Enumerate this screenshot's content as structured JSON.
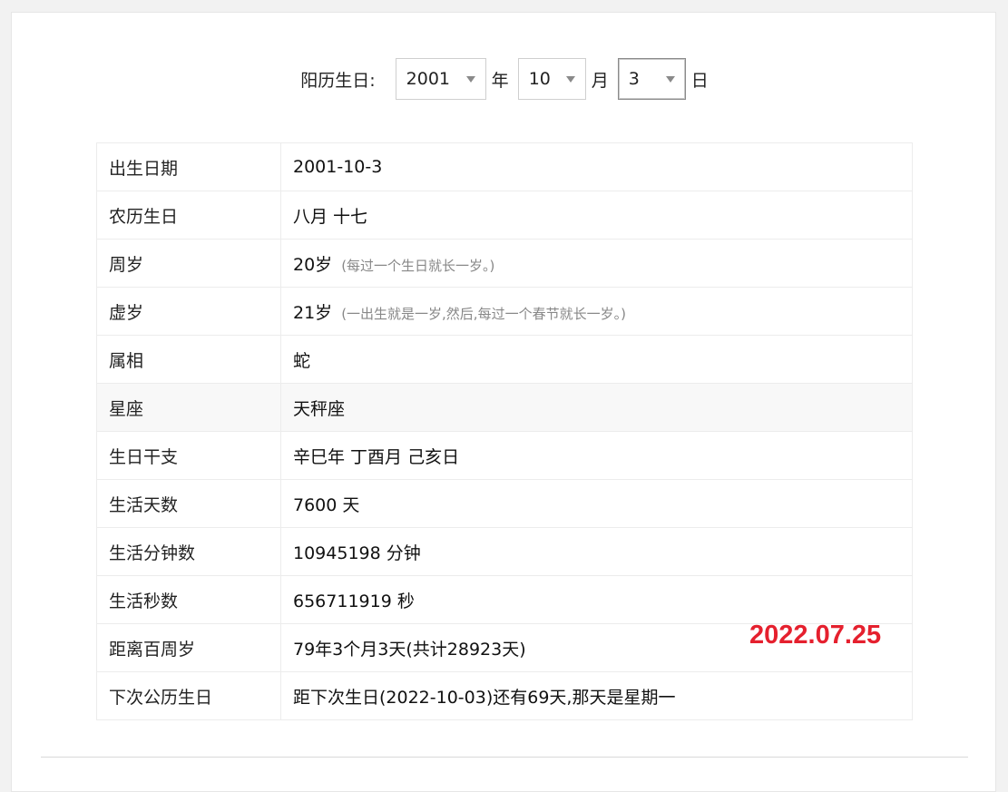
{
  "picker": {
    "label": "阳历生日:",
    "year_value": "2001",
    "year_unit": "年",
    "month_value": "10",
    "month_unit": "月",
    "day_value": "3",
    "day_unit": "日"
  },
  "rows": [
    {
      "key": "出生日期",
      "value": "2001-10-3",
      "note": ""
    },
    {
      "key": "农历生日",
      "value": "八月 十七",
      "note": ""
    },
    {
      "key": "周岁",
      "value": "20岁",
      "note": "(每过一个生日就长一岁。)"
    },
    {
      "key": "虚岁",
      "value": "21岁",
      "note": "(一出生就是一岁,然后,每过一个春节就长一岁。)"
    },
    {
      "key": "属相",
      "value": "蛇",
      "note": ""
    },
    {
      "key": "星座",
      "value": "天秤座",
      "note": ""
    },
    {
      "key": "生日干支",
      "value": "辛巳年 丁酉月 己亥日",
      "note": ""
    },
    {
      "key": "生活天数",
      "value": "7600 天",
      "note": ""
    },
    {
      "key": "生活分钟数",
      "value": "10945198 分钟",
      "note": ""
    },
    {
      "key": "生活秒数",
      "value": "656711919 秒",
      "note": ""
    },
    {
      "key": "距离百周岁",
      "value": "79年3个月3天(共计28923天)",
      "note": ""
    },
    {
      "key": "下次公历生日",
      "value": "距下次生日(2022-10-03)还有69天,那天是星期一",
      "note": ""
    }
  ],
  "stamp": "2022.07.25",
  "colors": {
    "stamp": "#e5202e",
    "highlight_row": "#f8f8f8"
  }
}
